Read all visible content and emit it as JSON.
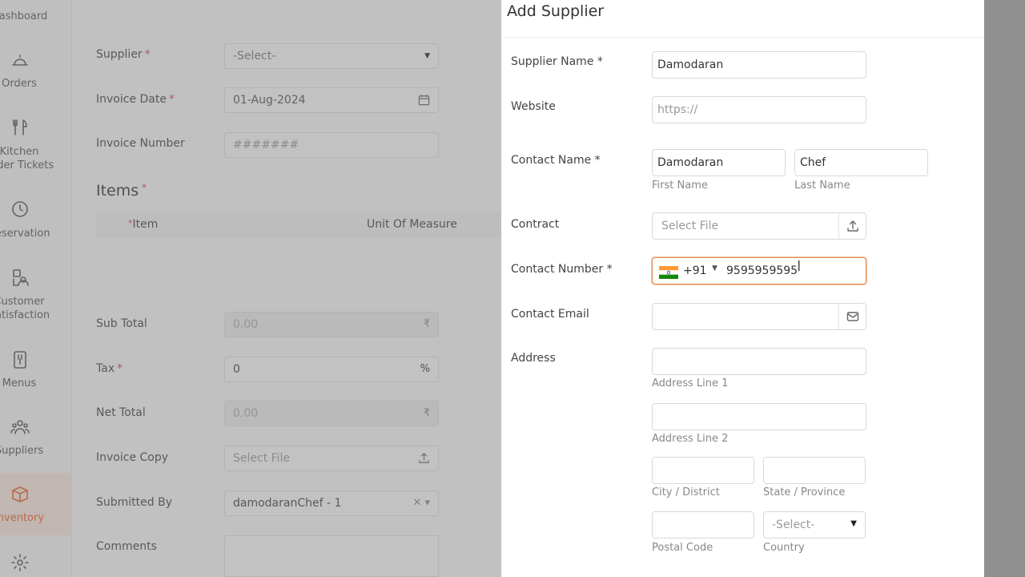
{
  "sidebar": {
    "items": [
      {
        "label": "Dashboard",
        "icon": "dashboard-icon"
      },
      {
        "label": "Orders",
        "icon": "cloche-icon"
      },
      {
        "label": "Kitchen\nOrder Tickets",
        "icon": "fork-knife-icon"
      },
      {
        "label": "Reservation",
        "icon": "clock-icon"
      },
      {
        "label": "Customer\nSatisfaction",
        "icon": "customer-icon"
      },
      {
        "label": "Menus",
        "icon": "menu-book-icon"
      },
      {
        "label": "Suppliers",
        "icon": "suppliers-icon"
      },
      {
        "label": "Inventory",
        "icon": "box-icon",
        "active": true
      },
      {
        "label": "",
        "icon": "gear-icon"
      }
    ]
  },
  "invoice": {
    "supplier_label": "Supplier",
    "supplier_value": "-Select-",
    "invoice_date_label": "Invoice Date",
    "invoice_date_value": "01-Aug-2024",
    "invoice_number_label": "Invoice Number",
    "invoice_number_placeholder": "#######",
    "items_title": "Items",
    "items_columns": [
      "Item",
      "Unit Of Measure"
    ],
    "sub_total_label": "Sub Total",
    "sub_total_value": "0.00",
    "currency_symbol": "₹",
    "tax_label": "Tax",
    "tax_value": "0",
    "tax_suffix": "%",
    "net_total_label": "Net Total",
    "net_total_value": "0.00",
    "invoice_copy_label": "Invoice Copy",
    "invoice_copy_placeholder": "Select File",
    "submitted_by_label": "Submitted By",
    "submitted_by_value": "damodaranChef - 1",
    "comments_label": "Comments"
  },
  "drawer": {
    "title": "Add Supplier",
    "supplier_name_label": "Supplier Name *",
    "supplier_name_value": "Damodaran",
    "website_label": "Website",
    "website_placeholder": "https://",
    "contact_name_label": "Contact Name *",
    "first_name_value": "Damodaran",
    "first_name_hint": "First Name",
    "last_name_value": "Chef",
    "last_name_hint": "Last Name",
    "contract_label": "Contract",
    "contract_placeholder": "Select File",
    "contact_number_label": "Contact Number *",
    "dial_code": "+91",
    "country_flag": "india-flag",
    "contact_number_value": "9595959595",
    "contact_email_label": "Contact Email",
    "address_label": "Address",
    "address_line1_hint": "Address Line 1",
    "address_line2_hint": "Address Line 2",
    "city_hint": "City / District",
    "state_hint": "State / Province",
    "postal_hint": "Postal Code",
    "country_value": "-Select-",
    "country_hint": "Country"
  },
  "colors": {
    "accent": "#e8622a",
    "focus_border": "#e08a4e",
    "required": "#e23b3b"
  }
}
